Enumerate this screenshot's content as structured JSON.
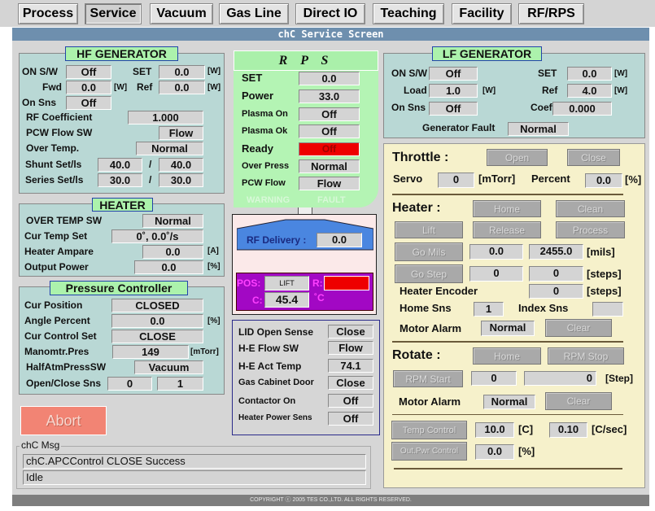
{
  "tabs": [
    "Process",
    "Service",
    "Vacuum",
    "Gas Line",
    "Direct IO",
    "Teaching",
    "Facility",
    "RF/RPS"
  ],
  "active_tab": "Service",
  "screen_title": "chC Service Screen",
  "hf": {
    "title": "HF GENERATOR",
    "on_sw_label": "ON S/W",
    "on_sw": "Off",
    "set_label": "SET",
    "set": "0.0",
    "unit_w": "[W]",
    "fwd_label": "Fwd",
    "fwd": "0.0",
    "ref_label": "Ref",
    "ref": "0.0",
    "on_sns_label": "On Sns",
    "on_sns": "Off",
    "rf_coef_label": "RF Coefficient",
    "rf_coef": "1.000",
    "pcw_label": "PCW Flow SW",
    "pcw": "Flow",
    "over_temp_label": "Over Temp.",
    "over_temp": "Normal",
    "shunt_label": "Shunt Set/ls",
    "shunt_set": "40.0",
    "shunt_is": "40.0",
    "series_label": "Series Set/ls",
    "series_set": "30.0",
    "series_is": "30.0",
    "slash": "/"
  },
  "heater": {
    "title": "HEATER",
    "over_temp_sw_label": "OVER TEMP SW",
    "over_temp_sw": "Normal",
    "cur_temp_set_label": "Cur Temp Set",
    "cur_temp_set": "0˚, 0.0˚/s",
    "ampare_label": "Heater Ampare",
    "ampare": "0.0",
    "ampare_unit": "[A]",
    "output_label": "Output Power",
    "output": "0.0",
    "output_unit": "[%]"
  },
  "pressure": {
    "title": "Pressure Controller",
    "cur_pos_label": "Cur Position",
    "cur_pos": "CLOSED",
    "angle_label": "Angle Percent",
    "angle": "0.0",
    "angle_unit": "[%]",
    "ctrl_set_label": "Cur Control Set",
    "ctrl_set": "CLOSE",
    "mano_label": "Manomtr.Pres",
    "mano": "149",
    "mano_unit": "[mTorr]",
    "half_label": "HalfAtmPressSW",
    "half": "Vacuum",
    "oc_label": "Open/Close Sns",
    "open": "0",
    "close": "1"
  },
  "abort_label": "Abort",
  "msg": {
    "title": "chC Msg",
    "lines": [
      "chC.APCControl CLOSE Success",
      "Idle"
    ]
  },
  "footer": "COPYRIGHT ⓒ 2005 TES CO.,LTD. ALL RIGHTS RESERVED.",
  "rps": {
    "title": "R P S",
    "rows": [
      {
        "label": "SET",
        "value": "0.0"
      },
      {
        "label": "Power",
        "value": "33.0"
      },
      {
        "label": "Plasma On",
        "value": "Off"
      },
      {
        "label": "Plasma Ok",
        "value": "Off"
      },
      {
        "label": "Ready",
        "value": "Off"
      },
      {
        "label": "Over Press",
        "value": "Normal"
      },
      {
        "label": "PCW Flow",
        "value": "Flow"
      }
    ],
    "warning": "WARNING",
    "fault": "FAULT",
    "ready_color": "#ee0000"
  },
  "rf": {
    "delivery_label": "RF Delivery :",
    "delivery": "0.0",
    "pos_label": "POS:",
    "pos": "LIFT",
    "r_label": "R:",
    "c_label": "C:",
    "c": "45.4",
    "c_unit": "˚C"
  },
  "lid": [
    {
      "label": "LID Open Sense",
      "value": "Close"
    },
    {
      "label": "H-E Flow SW",
      "value": "Flow"
    },
    {
      "label": "H-E Act Temp",
      "value": "74.1"
    },
    {
      "label": "Gas Cabinet Door",
      "value": "Close"
    },
    {
      "label": "Contactor On",
      "value": "Off"
    },
    {
      "label": "Heater Power Sens",
      "value": "Off"
    }
  ],
  "lf": {
    "title": "LF GENERATOR",
    "on_sw_label": "ON S/W",
    "on_sw": "Off",
    "set_label": "SET",
    "set": "0.0",
    "unit_w": "[W]",
    "load_label": "Load",
    "load": "1.0",
    "ref_label": "Ref",
    "ref": "4.0",
    "on_sns_label": "On Sns",
    "on_sns": "Off",
    "coeff_label": "Coeff",
    "coeff": "0.000",
    "fault_label": "Generator Fault",
    "fault": "Normal"
  },
  "throttle": {
    "title": "Throttle :",
    "open": "Open",
    "close": "Close",
    "servo_label": "Servo",
    "servo": "0",
    "servo_unit": "[mTorr]",
    "percent_label": "Percent",
    "percent": "0.0",
    "percent_unit": "[%]"
  },
  "heater_ctl": {
    "title": "Heater :",
    "home": "Home",
    "clean": "Clean",
    "lift": "Lift",
    "release": "Release",
    "process": "Process",
    "go_mils": "Go Mils",
    "mils_target": "0.0",
    "mils_cur": "2455.0",
    "mils_unit": "[mils]",
    "go_step": "Go Step",
    "step_target": "0",
    "step_cur": "0",
    "steps_unit": "[steps]",
    "encoder_label": "Heater Encoder",
    "encoder": "0",
    "home_sns_label": "Home Sns",
    "home_sns": "1",
    "index_sns_label": "Index Sns",
    "index_sns": "",
    "alarm_label": "Motor Alarm",
    "alarm": "Normal",
    "clear": "Clear"
  },
  "rotate": {
    "title": "Rotate :",
    "home": "Home",
    "rpm_stop": "RPM Stop",
    "rpm_start": "RPM Start",
    "rpm": "0",
    "step": "0",
    "step_unit": "[Step]",
    "alarm_label": "Motor Alarm",
    "alarm": "Normal",
    "clear": "Clear"
  },
  "temp": {
    "temp_control": "Temp Control",
    "temp": "10.0",
    "temp_unit": "[C]",
    "rate": "0.10",
    "rate_unit": "[C/sec]",
    "out_pwr": "Out.Pwr Control",
    "out": "0.0",
    "out_unit": "[%]"
  }
}
